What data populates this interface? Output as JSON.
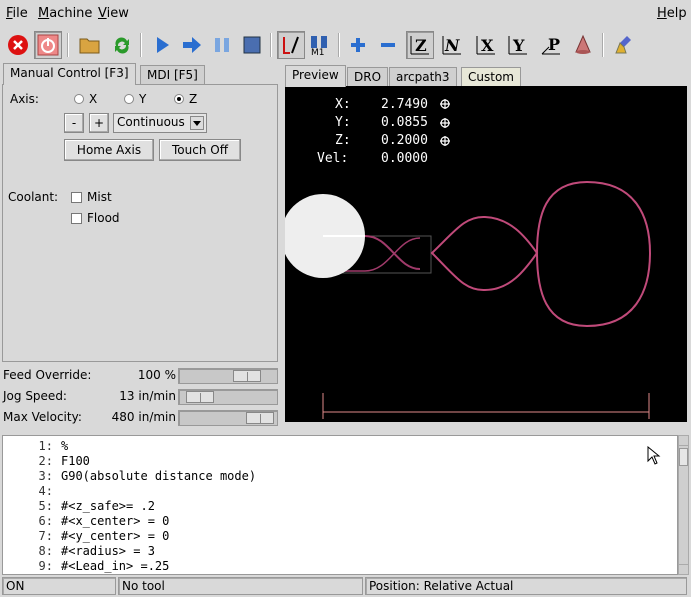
{
  "menu": {
    "file": "File",
    "machine": "Machine",
    "view": "View",
    "help": "Help"
  },
  "menu_mnemonics": {
    "file": "F",
    "machine": "M",
    "view": "V",
    "help": "H"
  },
  "toolbar": {
    "icons": [
      "estop-icon",
      "power-icon",
      "open-file-icon",
      "reload-icon",
      "run-icon",
      "step-icon",
      "pause-icon",
      "stop-icon",
      "block-delete-icon",
      "optional-stop-icon",
      "zoom-in-icon",
      "zoom-out-icon",
      "view-z-icon",
      "view-z2-icon",
      "view-x-icon",
      "view-y-icon",
      "view-p-icon",
      "rotate-view-icon",
      "clear-plot-icon"
    ]
  },
  "left_tabs": [
    "Manual Control [F3]",
    "MDI [F5]"
  ],
  "manual": {
    "axis_label": "Axis:",
    "axes": [
      "X",
      "Y",
      "Z"
    ],
    "selected_axis": "Z",
    "minus_label": "-",
    "plus_label": "+",
    "jog_mode": "Continuous",
    "home_label": "Home Axis",
    "touch_off_label": "Touch Off",
    "coolant_label": "Coolant:",
    "mist_label": "Mist",
    "flood_label": "Flood"
  },
  "sliders": {
    "feed": {
      "label": "Feed Override:",
      "value": "100 %",
      "fraction": 0.77
    },
    "jog": {
      "label": "Jog Speed:",
      "value": "13 in/min",
      "fraction": 0.1
    },
    "maxvel": {
      "label": "Max Velocity:",
      "value": "480 in/min",
      "fraction": 0.95
    }
  },
  "right_tabs": [
    "Preview",
    "DRO",
    "arcpath3",
    "Custom"
  ],
  "dro": {
    "x_label": "X:",
    "x_value": "2.7490",
    "y_label": "Y:",
    "y_value": "0.0855",
    "z_label": "Z:",
    "z_value": "0.2000",
    "vel_label": "Vel:",
    "vel_value": "0.0000"
  },
  "gcode": [
    {
      "n": "1:",
      "t": "%"
    },
    {
      "n": "2:",
      "t": "F100"
    },
    {
      "n": "3:",
      "t": "G90(absolute distance mode)"
    },
    {
      "n": "4:",
      "t": ""
    },
    {
      "n": "5:",
      "t": "#<z_safe>= .2"
    },
    {
      "n": "6:",
      "t": "#<x_center> = 0"
    },
    {
      "n": "7:",
      "t": "#<y_center> = 0"
    },
    {
      "n": "8:",
      "t": "#<radius> = 3"
    },
    {
      "n": "9:",
      "t": "#<Lead_in> =.25"
    }
  ],
  "status": {
    "state": "ON",
    "tool": "No tool",
    "position": "Position: Relative Actual"
  },
  "colors": {
    "path": "#c04a7a",
    "feed_path": "#a03a6a",
    "extents": "#e08a8a",
    "preview_bg": "#000000"
  }
}
